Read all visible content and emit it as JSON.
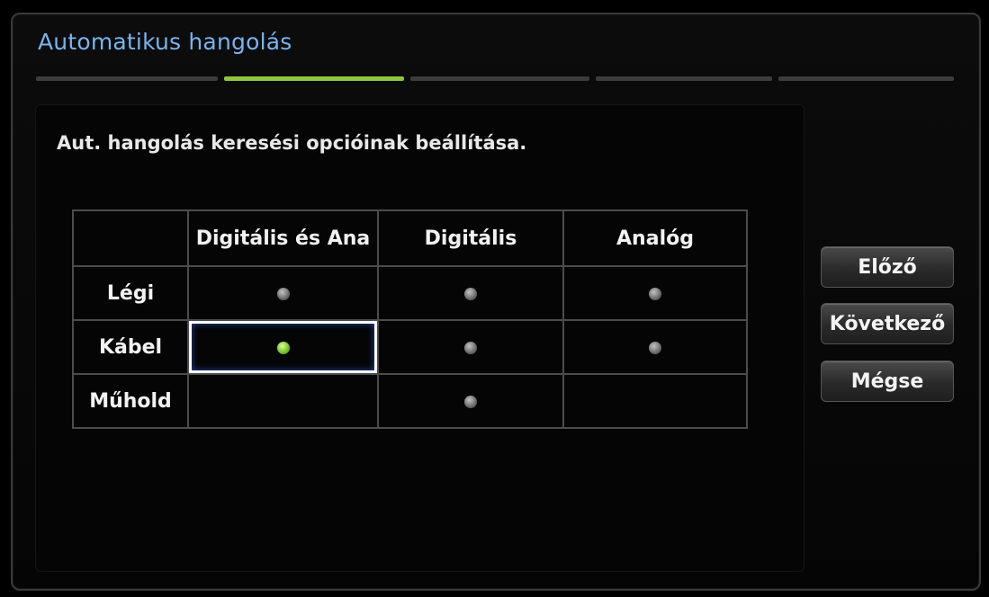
{
  "dialog": {
    "title": "Automatikus hangolás",
    "steps": [
      {
        "active": false
      },
      {
        "active": true
      },
      {
        "active": false
      },
      {
        "active": false
      },
      {
        "active": false
      }
    ],
    "instruction": "Aut. hangolás keresési opcióinak beállítása."
  },
  "grid": {
    "columns": [
      "Digitális és Ana",
      "Digitális",
      "Analóg"
    ],
    "rows": [
      {
        "label": "Légi",
        "cells": [
          "off",
          "off",
          "off"
        ]
      },
      {
        "label": "Kábel",
        "cells": [
          "on",
          "off",
          "off"
        ]
      },
      {
        "label": "Műhold",
        "cells": [
          "none",
          "off",
          "none"
        ]
      }
    ],
    "selected": {
      "row": 1,
      "col": 0
    }
  },
  "buttons": {
    "prev": "Előző",
    "next": "Következő",
    "cancel": "Mégse"
  },
  "colors": {
    "title": "#78b4ee",
    "active_step": "#8dc63f",
    "selected_dot": "#7cc52a",
    "focus_glow": "#3b6fd6"
  }
}
